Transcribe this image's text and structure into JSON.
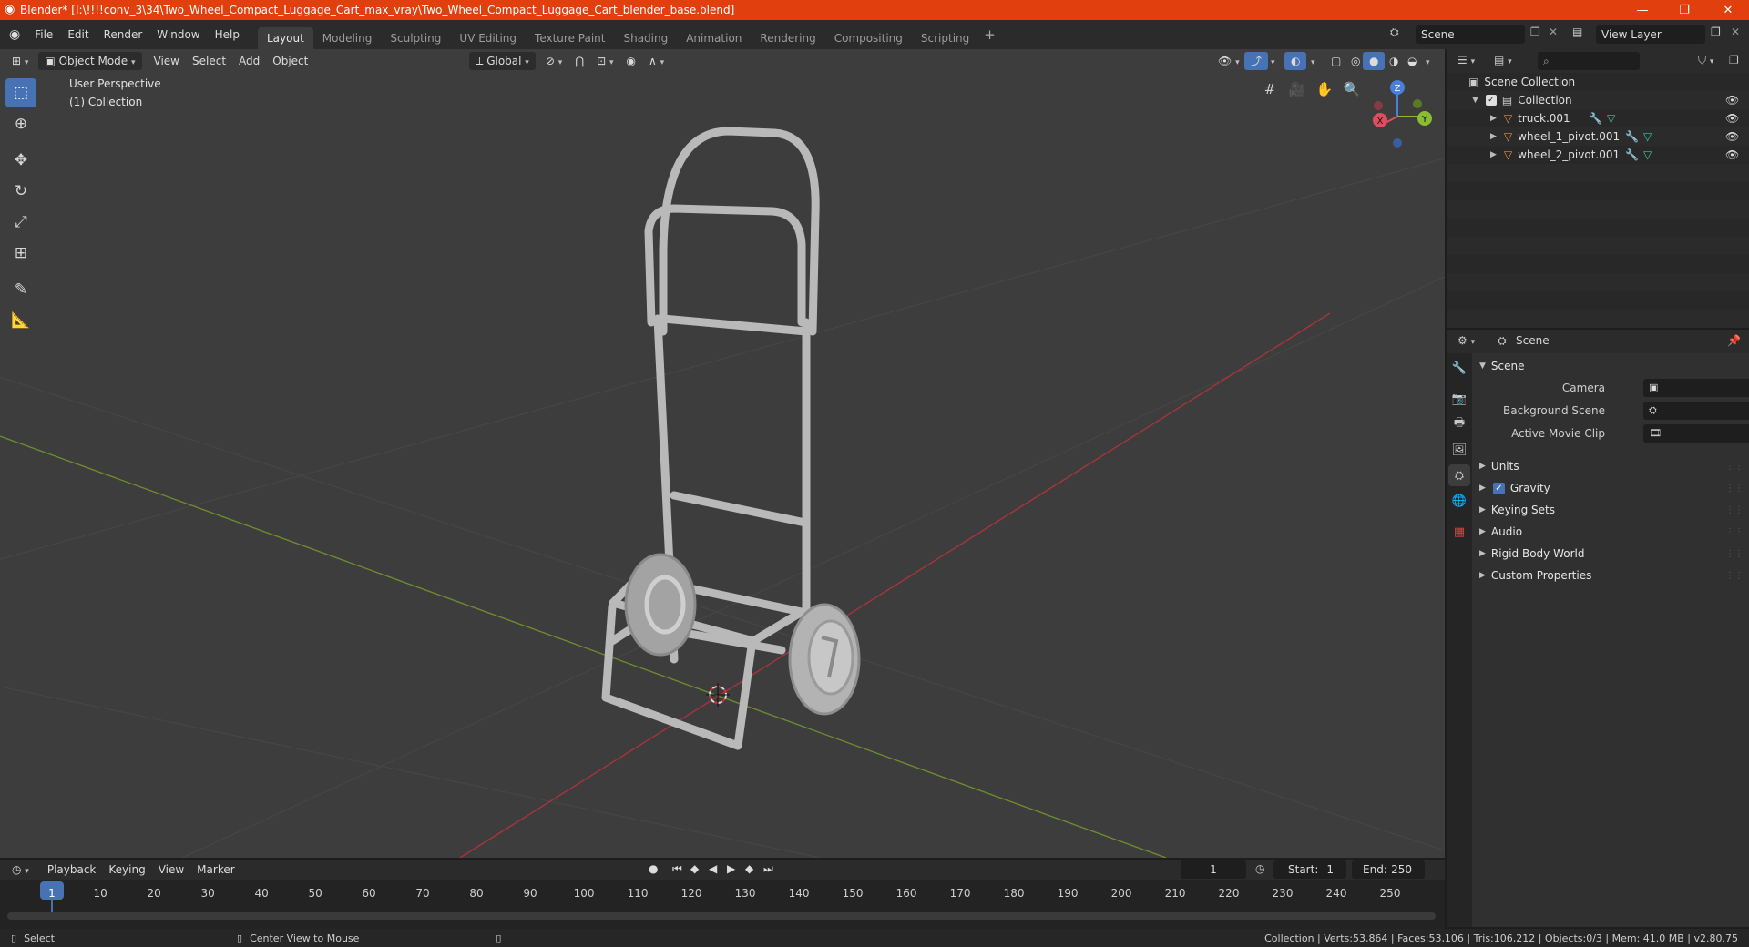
{
  "window": {
    "title": "Blender* [I:\\!!!!conv_3\\34\\Two_Wheel_Compact_Luggage_Cart_max_vray\\Two_Wheel_Compact_Luggage_Cart_blender_base.blend]",
    "accent_color": "#e1400e"
  },
  "menus": [
    "File",
    "Edit",
    "Render",
    "Window",
    "Help"
  ],
  "workspaces": [
    "Layout",
    "Modeling",
    "Sculpting",
    "UV Editing",
    "Texture Paint",
    "Shading",
    "Animation",
    "Rendering",
    "Compositing",
    "Scripting"
  ],
  "active_workspace": "Layout",
  "scene_selector": {
    "value": "Scene"
  },
  "view_layer_selector": {
    "value": "View Layer"
  },
  "viewport": {
    "mode": "Object Mode",
    "menus": [
      "View",
      "Select",
      "Add",
      "Object"
    ],
    "transform_orientation": "Global",
    "overlay_line1": "User Perspective",
    "overlay_line2": "(1) Collection",
    "gizmo_labels": {
      "x": "X",
      "y": "Y",
      "z": "Z"
    },
    "background": "#3d3d3d"
  },
  "outliner": {
    "root": "Scene Collection",
    "collection": "Collection",
    "objects": [
      {
        "name": "truck.001"
      },
      {
        "name": "wheel_1_pivot.001"
      },
      {
        "name": "wheel_2_pivot.001"
      }
    ]
  },
  "properties": {
    "context": "Scene",
    "panel_title": "Scene",
    "fields": [
      {
        "label": "Camera"
      },
      {
        "label": "Background Scene"
      },
      {
        "label": "Active Movie Clip"
      }
    ],
    "sections": [
      "Units",
      "Gravity",
      "Keying Sets",
      "Audio",
      "Rigid Body World",
      "Custom Properties"
    ],
    "gravity_checked": true
  },
  "timeline": {
    "menus": [
      "Playback",
      "Keying",
      "View",
      "Marker"
    ],
    "current_frame": "1",
    "start_label": "Start:",
    "start": "1",
    "end_label": "End:",
    "end": "250",
    "ticks": [
      "1",
      "10",
      "20",
      "30",
      "40",
      "50",
      "60",
      "70",
      "80",
      "90",
      "100",
      "110",
      "120",
      "130",
      "140",
      "150",
      "160",
      "170",
      "180",
      "190",
      "200",
      "210",
      "220",
      "230",
      "240",
      "250"
    ]
  },
  "statusbar": {
    "left_action": "Select",
    "middle_action": "Center View to Mouse",
    "stats": "Collection | Verts:53,864 | Faces:53,106 | Tris:106,212 | Objects:0/3 | Mem: 41.0 MB | v2.80.75"
  }
}
